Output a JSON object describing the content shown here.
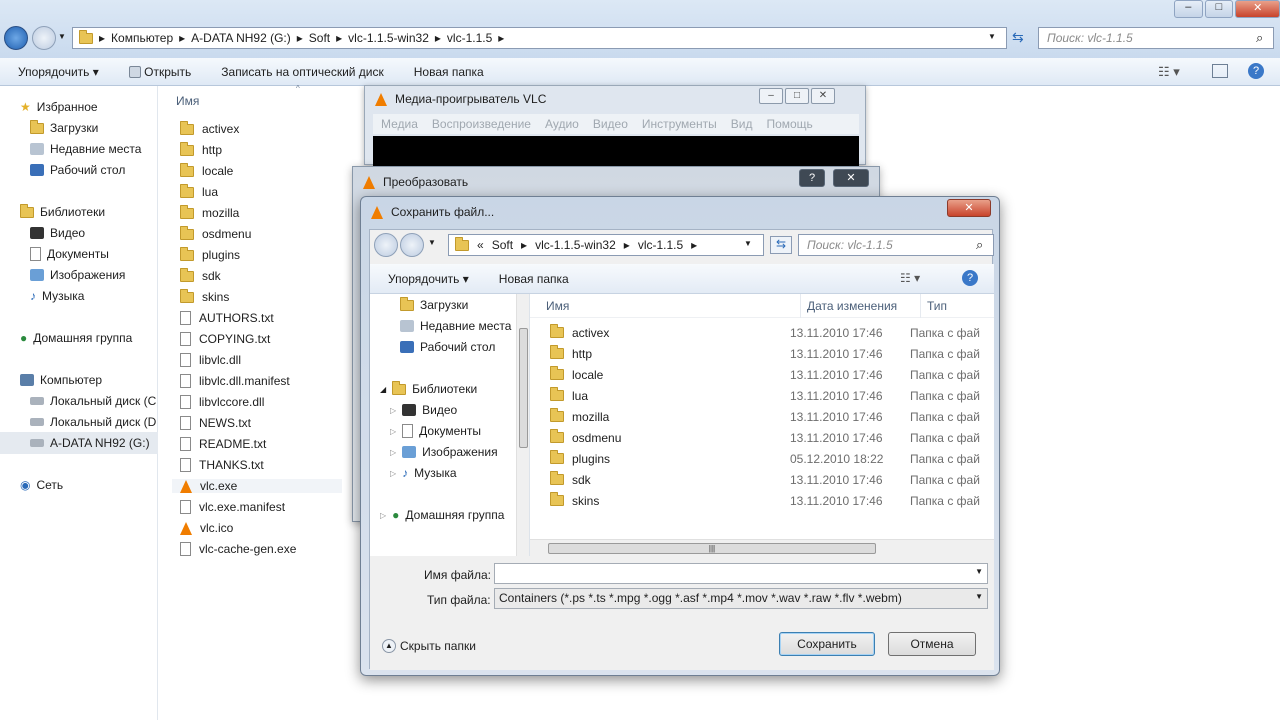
{
  "explorer": {
    "breadcrumb": [
      "Компьютер",
      "A-DATA NH92 (G:)",
      "Soft",
      "vlc-1.1.5-win32",
      "vlc-1.1.5"
    ],
    "search_placeholder": "Поиск: vlc-1.1.5",
    "toolbar": {
      "organize": "Упорядочить",
      "open": "Открыть",
      "burn": "Записать на оптический диск",
      "new_folder": "Новая папка"
    },
    "nav": {
      "favorites": "Избранное",
      "downloads": "Загрузки",
      "recent": "Недавние места",
      "desktop": "Рабочий стол",
      "libraries": "Библиотеки",
      "video": "Видео",
      "docs": "Документы",
      "images": "Изображения",
      "music": "Музыка",
      "homegroup": "Домашняя группа",
      "computer": "Компьютер",
      "local_c": "Локальный диск (C",
      "local_d": "Локальный диск (D",
      "adata": "A-DATA NH92 (G:)",
      "network": "Сеть"
    },
    "column_name": "Имя",
    "files": [
      "activex",
      "http",
      "locale",
      "lua",
      "mozilla",
      "osdmenu",
      "plugins",
      "sdk",
      "skins",
      "AUTHORS.txt",
      "COPYING.txt",
      "libvlc.dll",
      "libvlc.dll.manifest",
      "libvlccore.dll",
      "NEWS.txt",
      "README.txt",
      "THANKS.txt",
      "vlc.exe",
      "vlc.exe.manifest",
      "vlc.ico",
      "vlc-cache-gen.exe"
    ]
  },
  "vlc": {
    "title": "Медиа-проигрыватель VLC",
    "menu": [
      "Медиа",
      "Воспроизведение",
      "Аудио",
      "Видео",
      "Инструменты",
      "Вид",
      "Помощь"
    ]
  },
  "convert": {
    "title": "Преобразовать",
    "help": "?",
    "close": "✕"
  },
  "save": {
    "title": "Сохранить файл...",
    "close": "✕",
    "breadcrumb": [
      "«",
      "Soft",
      "vlc-1.1.5-win32",
      "vlc-1.1.5"
    ],
    "search_placeholder": "Поиск: vlc-1.1.5",
    "toolbar": {
      "organize": "Упорядочить",
      "new_folder": "Новая папка"
    },
    "tree": {
      "downloads": "Загрузки",
      "recent": "Недавние места",
      "desktop": "Рабочий стол",
      "libraries": "Библиотеки",
      "video": "Видео",
      "docs": "Документы",
      "images": "Изображения",
      "music": "Музыка",
      "homegroup": "Домашняя группа"
    },
    "columns": {
      "name": "Имя",
      "date": "Дата изменения",
      "type": "Тип"
    },
    "rows": [
      {
        "name": "activex",
        "date": "13.11.2010 17:46",
        "type": "Папка с фай"
      },
      {
        "name": "http",
        "date": "13.11.2010 17:46",
        "type": "Папка с фай"
      },
      {
        "name": "locale",
        "date": "13.11.2010 17:46",
        "type": "Папка с фай"
      },
      {
        "name": "lua",
        "date": "13.11.2010 17:46",
        "type": "Папка с фай"
      },
      {
        "name": "mozilla",
        "date": "13.11.2010 17:46",
        "type": "Папка с фай"
      },
      {
        "name": "osdmenu",
        "date": "13.11.2010 17:46",
        "type": "Папка с фай"
      },
      {
        "name": "plugins",
        "date": "05.12.2010 18:22",
        "type": "Папка с фай"
      },
      {
        "name": "sdk",
        "date": "13.11.2010 17:46",
        "type": "Папка с фай"
      },
      {
        "name": "skins",
        "date": "13.11.2010 17:46",
        "type": "Папка с фай"
      }
    ],
    "filename_label": "Имя файла:",
    "filename_value": "",
    "filetype_label": "Тип файла:",
    "filetype_value": "Containers (*.ps *.ts *.mpg *.ogg *.asf *.mp4 *.mov *.wav *.raw *.flv *.webm)",
    "hide_folders": "Скрыть папки",
    "save_button": "Сохранить",
    "cancel_button": "Отмена"
  },
  "colors": {
    "accent": "#3c7fb1",
    "folder": "#e8c455",
    "vlc_orange": "#f07d00"
  }
}
